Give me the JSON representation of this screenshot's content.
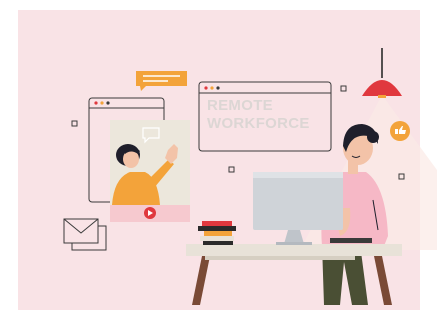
{
  "illustration": {
    "heading_line1": "REMOTE",
    "heading_line2": "WORKFORCE"
  },
  "colors": {
    "background": "#f9e3e6",
    "accent_red": "#e0383e",
    "accent_orange": "#f3a33a",
    "window_stroke": "#3a3a3a",
    "monitor": "#cfd3d8",
    "skin": "#f3c3a8",
    "hair": "#1f1f2b",
    "shirt_pink": "#f6b8c6",
    "pants": "#4a4f34",
    "desk_top": "#e8e2d8",
    "desk_legs": "#7a4a36"
  },
  "icons": [
    "browser-window-icon",
    "video-call-frame",
    "chat-bubble-icon",
    "play-button-icon",
    "envelope-icon",
    "thumbs-up-icon",
    "pendant-lamp",
    "desktop-monitor",
    "book-stack",
    "decorative-square-icon"
  ]
}
